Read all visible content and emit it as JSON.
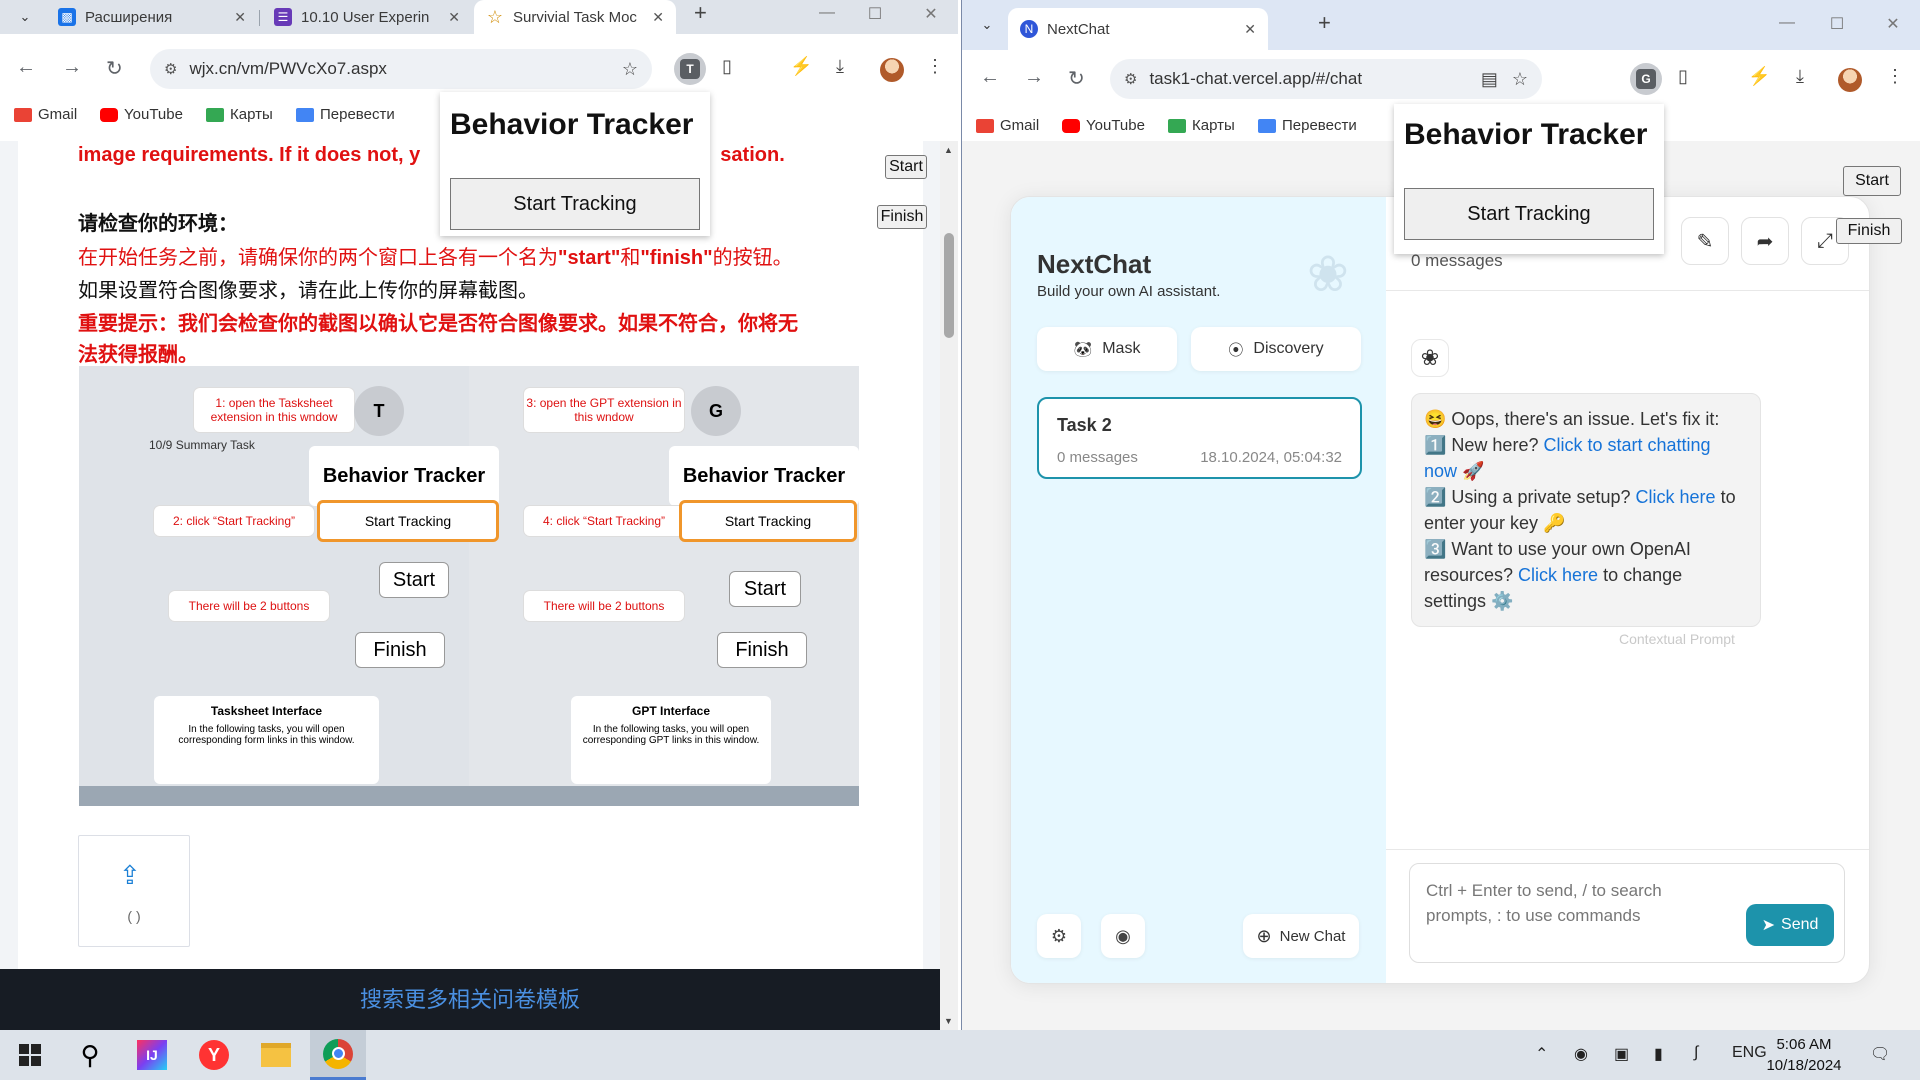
{
  "left_window": {
    "tabs": [
      {
        "title": "Расширения",
        "icon": "puzzle-icon",
        "color": "#1a73e8"
      },
      {
        "title": "10.10 User Experin",
        "icon": "form-icon",
        "color": "#673ab7"
      },
      {
        "title": "Survivial Task Moc",
        "icon": "star-icon",
        "color": "#e8a000"
      }
    ],
    "url": "wjx.cn/vm/PWVcXo7.aspx",
    "ext_letter": "T",
    "bookmarks": [
      "Gmail",
      "YouTube",
      "Карты",
      "Перевести"
    ],
    "content": {
      "red_line1": "image requirements. If it does not, y",
      "red_line1_tail": "sation.",
      "heading": "请检查你的环境：",
      "red_line2_a": "在开始任务之前，请确保你的两个窗口上各有一个名为",
      "red_line2_b": "\"start\"",
      "red_line2_c": "和",
      "red_line2_d": "\"finish\"",
      "red_line2_e": "的按钮。",
      "plain_line": "如果设置符合图像要求，请在此上传你的屏幕截图。",
      "important_1": "重要提示：我们会检查你的截图以确认它是否符合图像要求。如果不符合，你将无",
      "important_2": "法获得报酬。",
      "upload_count": "( )",
      "footer": "搜索更多相关问卷模板"
    },
    "screenshot": {
      "callout1": "1: open the Tasksheet extension in this wndow",
      "callout2": "2: click “Start Tracking”",
      "callout3": "3: open the GPT extension in this wndow",
      "callout4": "4: click “Start Tracking”",
      "two_buttons": "There will be 2 buttons",
      "bt_title": "Behavior Tracker",
      "bt_button": "Start Tracking",
      "start": "Start",
      "finish": "Finish",
      "left_title": "Tasksheet Interface",
      "left_desc": "In the following tasks, you will open corresponding form links in this window.",
      "right_title": "GPT Interface",
      "right_desc": "In the following tasks, you will open corresponding GPT links in this window.",
      "doc_title": "10/9 Summary Task",
      "ext_t": "T",
      "ext_g": "G"
    },
    "start_btn": "Start",
    "finish_btn": "Finish",
    "tracker": {
      "title": "Behavior Tracker",
      "button": "Start Tracking"
    }
  },
  "right_window": {
    "tab": {
      "title": "NextChat",
      "icon": "nextchat-icon",
      "color": "#2f56d8"
    },
    "url": "task1-chat.vercel.app/#/chat",
    "ext_letter": "G",
    "bookmarks": [
      "Gmail",
      "YouTube",
      "Карты",
      "Перевести"
    ],
    "tracker": {
      "title": "Behavior Tracker",
      "button": "Start Tracking"
    },
    "start_btn": "Start",
    "finish_btn": "Finish",
    "sidebar": {
      "brand": "NextChat",
      "subtitle": "Build your own AI assistant.",
      "mask": "Mask",
      "discovery": "Discovery",
      "session": {
        "title": "Task 2",
        "count": "0 messages",
        "date": "18.10.2024, 05:04:32"
      },
      "new_chat": "New Chat"
    },
    "chat": {
      "message_count": "0 messages",
      "line0": "😆 Oops, there's an issue. Let's fix it:",
      "l1_pre": "1️⃣ New here? ",
      "l1_link": "Click to start chatting now",
      "l1_post": " 🚀",
      "l2_pre": "2️⃣ Using a private setup? ",
      "l2_link": "Click here",
      "l2_post": " to enter your key 🔑",
      "l3_pre": "3️⃣ Want to use your own OpenAI resources? ",
      "l3_link": "Click here",
      "l3_post": " to change settings ⚙️",
      "context_prompt": "Contextual Prompt",
      "input_placeholder": "Ctrl + Enter to send, / to search prompts, : to use commands",
      "send": "Send"
    }
  },
  "taskbar": {
    "lang": "ENG",
    "time": "5:06 AM",
    "date": "10/18/2024"
  },
  "colors": {
    "accent": "#1d93ab",
    "required_red": "#e01111",
    "link_blue": "#1673d8"
  }
}
